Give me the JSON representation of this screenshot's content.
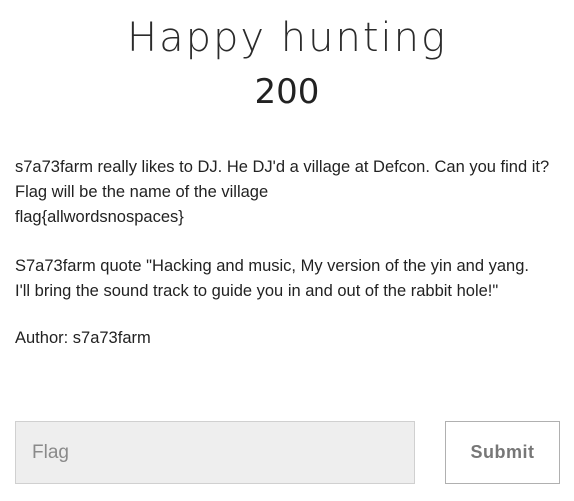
{
  "challenge": {
    "title": "Happy hunting",
    "points": "200",
    "description": [
      "s7a73farm really likes to DJ. He DJ'd a village at Defcon. Can you find it?",
      "Flag will be the name of the village",
      "flag{allwordsnospaces}"
    ],
    "quote": [
      "S7a73farm quote \"Hacking and music, My version of the yin and yang.",
      "I'll bring the sound track to guide you in and out of the rabbit hole!\""
    ],
    "author": "Author: s7a73farm"
  },
  "form": {
    "flag_placeholder": "Flag",
    "flag_value": "",
    "submit_label": "Submit"
  }
}
